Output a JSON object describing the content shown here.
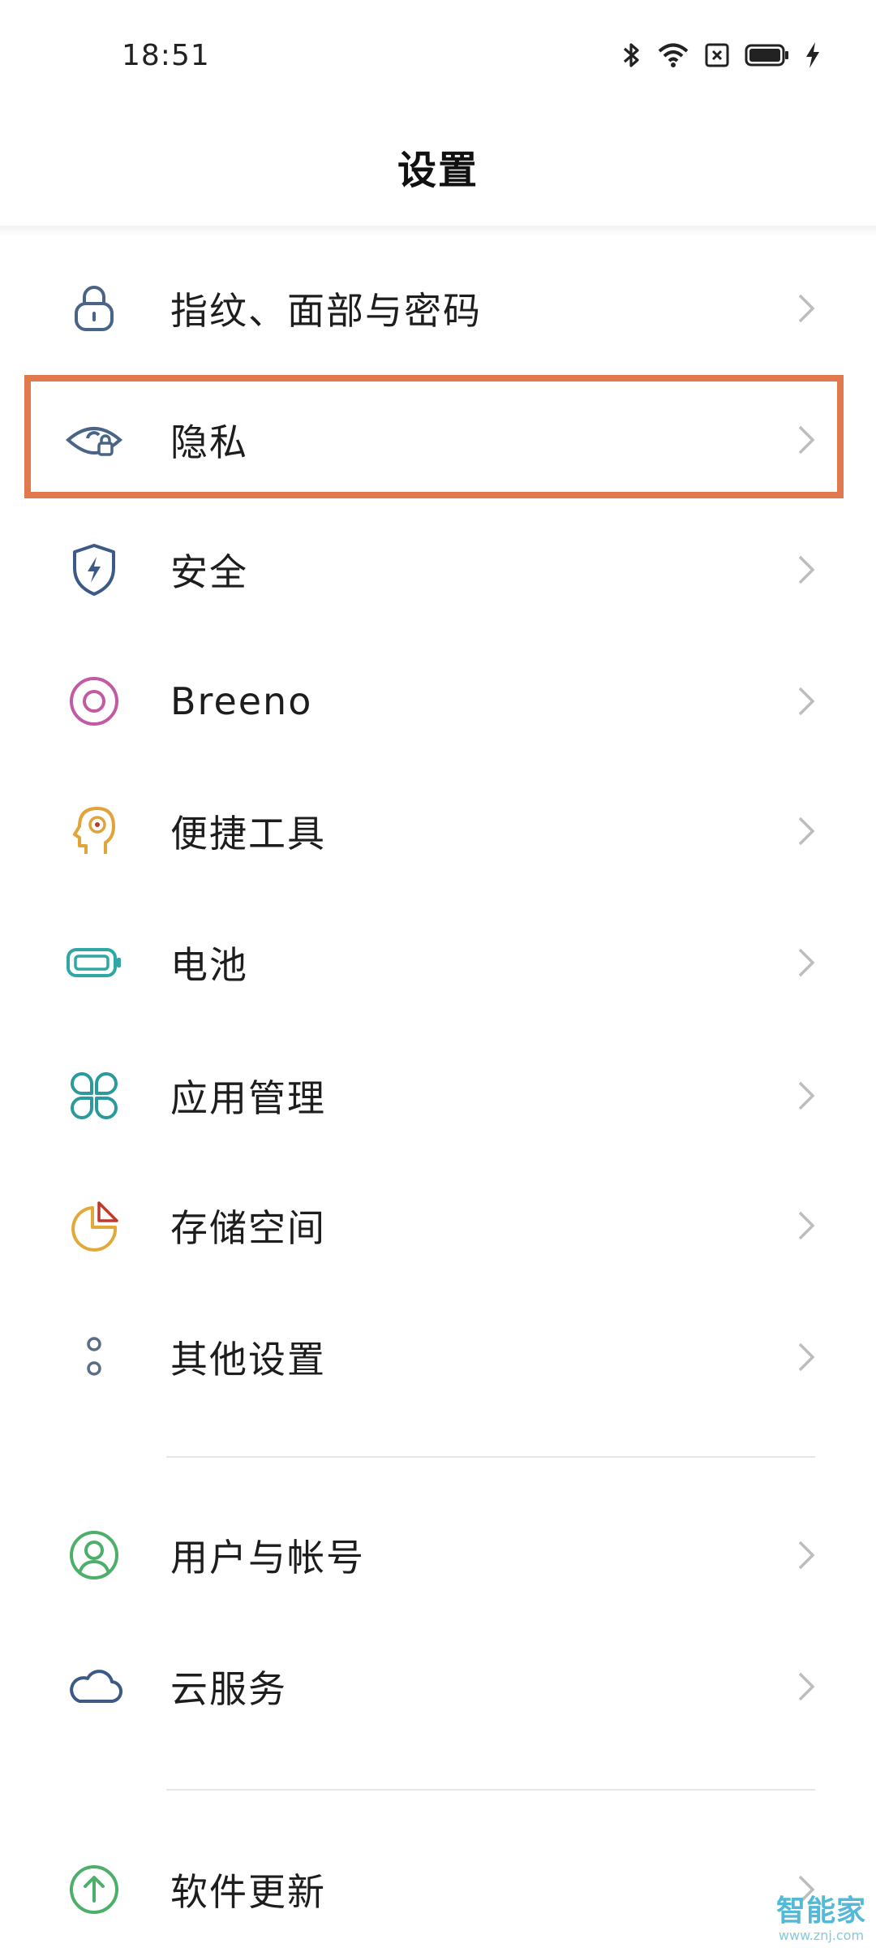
{
  "status_bar": {
    "time": "18:51",
    "icons": [
      "bluetooth-icon",
      "wifi-icon",
      "no-sim-icon",
      "battery-icon",
      "charging-bolt-icon"
    ]
  },
  "header": {
    "title": "设置"
  },
  "menu": {
    "items": [
      {
        "label": "指纹、面部与密码",
        "icon": "lock-icon",
        "color": "#4a6486"
      },
      {
        "label": "隐私",
        "icon": "privacy-eye-icon",
        "color": "#4a6486"
      },
      {
        "label": "安全",
        "icon": "shield-icon",
        "color": "#3c5a85"
      },
      {
        "label": "Breeno",
        "icon": "breeno-icon",
        "color": "#c25aa4"
      },
      {
        "label": "便捷工具",
        "icon": "head-tools-icon",
        "color": "#e0a43a"
      },
      {
        "label": "电池",
        "icon": "battery-icon",
        "color": "#2fa7a4"
      },
      {
        "label": "应用管理",
        "icon": "apps-grid-icon",
        "color": "#2a9a9a"
      },
      {
        "label": "存储空间",
        "icon": "storage-pie-icon",
        "color": "#e3a83a"
      },
      {
        "label": "其他设置",
        "icon": "more-dots-icon",
        "color": "#5a6e86"
      },
      {
        "label": "用户与帐号",
        "icon": "user-icon",
        "color": "#4caf6a"
      },
      {
        "label": "云服务",
        "icon": "cloud-icon",
        "color": "#3c5a85"
      },
      {
        "label": "软件更新",
        "icon": "update-arrow-icon",
        "color": "#4caf6a"
      }
    ]
  },
  "highlight": {
    "target": "隐私",
    "color": "#e07a4e"
  },
  "watermark": {
    "text": "智能家",
    "url": "www.znj.com"
  }
}
